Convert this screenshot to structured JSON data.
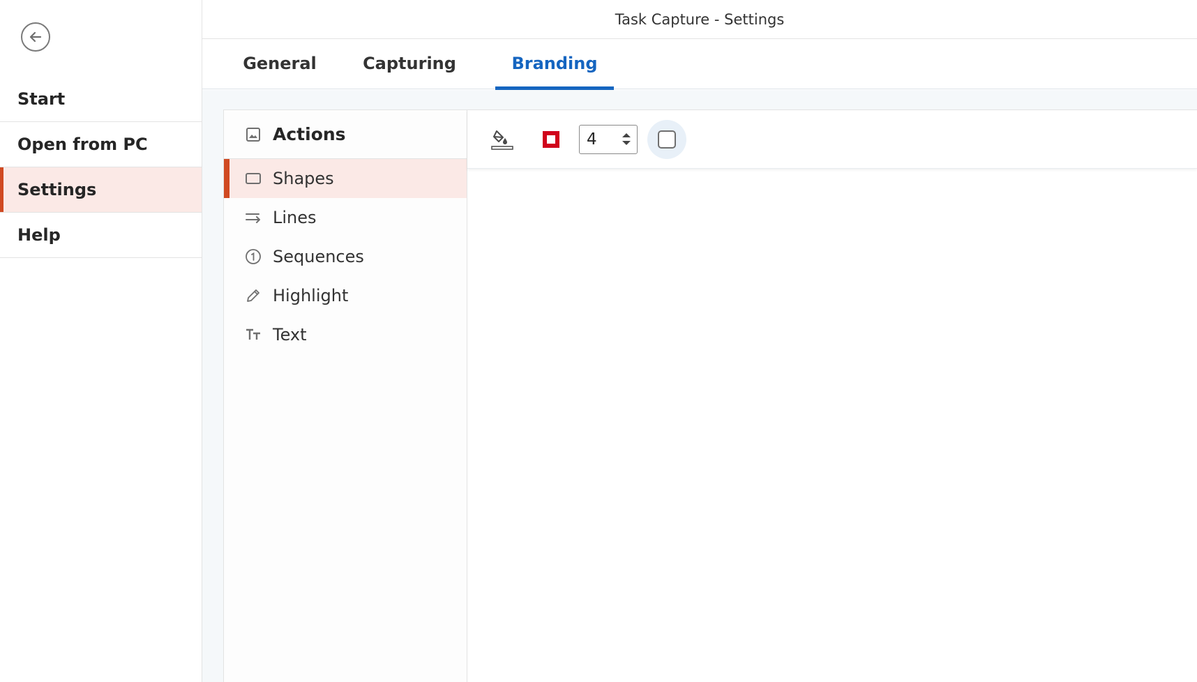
{
  "window": {
    "title": "Task Capture - Settings"
  },
  "sidebar": {
    "back_icon": "arrow-left-circle-icon",
    "items": [
      {
        "label": "Start"
      },
      {
        "label": "Open from PC"
      },
      {
        "label": "Settings",
        "active": true
      },
      {
        "label": "Help"
      }
    ]
  },
  "tabs": [
    {
      "label": "General"
    },
    {
      "label": "Capturing"
    },
    {
      "label": "Branding",
      "active": true
    }
  ],
  "actions": {
    "header": "Actions",
    "header_icon": "image-icon",
    "items": [
      {
        "label": "Shapes",
        "icon": "rectangle-icon",
        "active": true
      },
      {
        "label": "Lines",
        "icon": "arrow-lines-icon"
      },
      {
        "label": "Sequences",
        "icon": "numbered-circle-icon"
      },
      {
        "label": "Highlight",
        "icon": "pencil-icon"
      },
      {
        "label": "Text",
        "icon": "text-size-icon"
      }
    ]
  },
  "toolbar": {
    "fill_icon": "paint-bucket-icon",
    "border_color": "#d0021b",
    "border_width": "4",
    "shadow_checked": false
  },
  "colors": {
    "accent_blue": "#1565c0",
    "accent_red": "#d04a22",
    "active_bg": "#fbe9e6"
  }
}
